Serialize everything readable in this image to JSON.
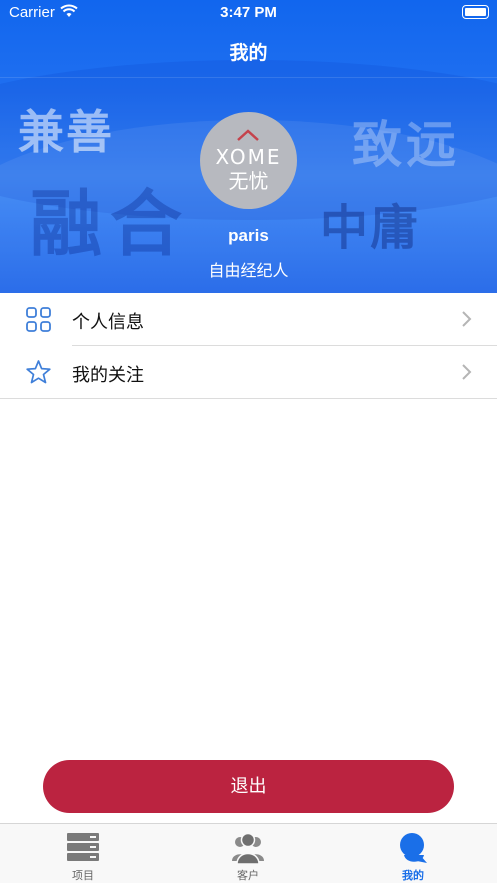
{
  "status_bar": {
    "carrier": "Carrier",
    "time": "3:47 PM"
  },
  "nav": {
    "title": "我的"
  },
  "banner": {
    "background_text": [
      "兼善",
      "融合",
      "致远",
      "中庸"
    ],
    "avatar_logo_text": "HOME 无忧",
    "username": "paris",
    "role": "自由经纪人"
  },
  "menu": {
    "items": [
      {
        "label": "个人信息",
        "icon": "grid-icon"
      },
      {
        "label": "我的关注",
        "icon": "star-icon"
      }
    ]
  },
  "logout_label": "退出",
  "tabbar": {
    "tabs": [
      {
        "label": "项目",
        "icon": "server-stack-icon",
        "active": false
      },
      {
        "label": "客户",
        "icon": "people-icon",
        "active": false
      },
      {
        "label": "我的",
        "icon": "person-icon",
        "active": true
      }
    ]
  },
  "colors": {
    "accent": "#1a6fe8",
    "logout": "#bb2340",
    "banner": "#1f6ff0"
  }
}
